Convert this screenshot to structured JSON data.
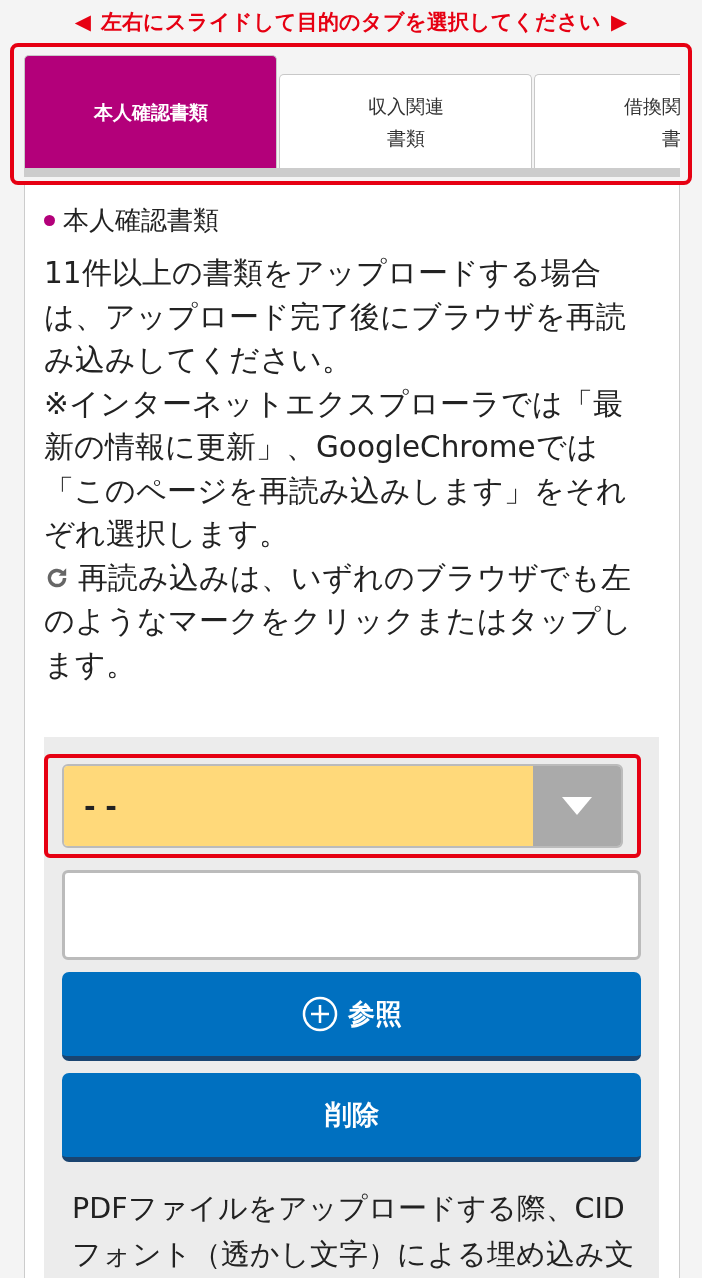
{
  "instruction": {
    "left_arrow": "◀",
    "text": "左右にスライドして目的のタブを選択してください",
    "right_arrow": "▶"
  },
  "tabs": [
    {
      "lines": [
        "本人確認書類"
      ],
      "selected": true
    },
    {
      "lines": [
        "収入関連",
        "書類"
      ],
      "selected": false
    },
    {
      "lines": [
        "借換関",
        "書"
      ],
      "selected": false
    }
  ],
  "section": {
    "title": "本人確認書類",
    "paragraphs": [
      {
        "kind": "text",
        "text": "11件以上の書類をアップロードする場合は、アップロード完了後にブラウザを再読み込みしてください。"
      },
      {
        "kind": "text",
        "text": "※インターネットエクスプローラでは「最新の情報に更新」、GoogleChromeでは「このページを再読み込みします」をそれぞれ選択します。"
      },
      {
        "kind": "reload",
        "text": "再読み込みは、いずれのブラウザでも左のようなマークをクリックまたはタップします。"
      }
    ]
  },
  "upload": {
    "select": {
      "value": "- -"
    },
    "buttons": [
      {
        "kind": "browse",
        "label": "参照"
      },
      {
        "kind": "delete",
        "label": "削除"
      }
    ],
    "note": "PDFファイルをアップロードする際、CIDフォント（透かし文字）による埋め込み文"
  }
}
